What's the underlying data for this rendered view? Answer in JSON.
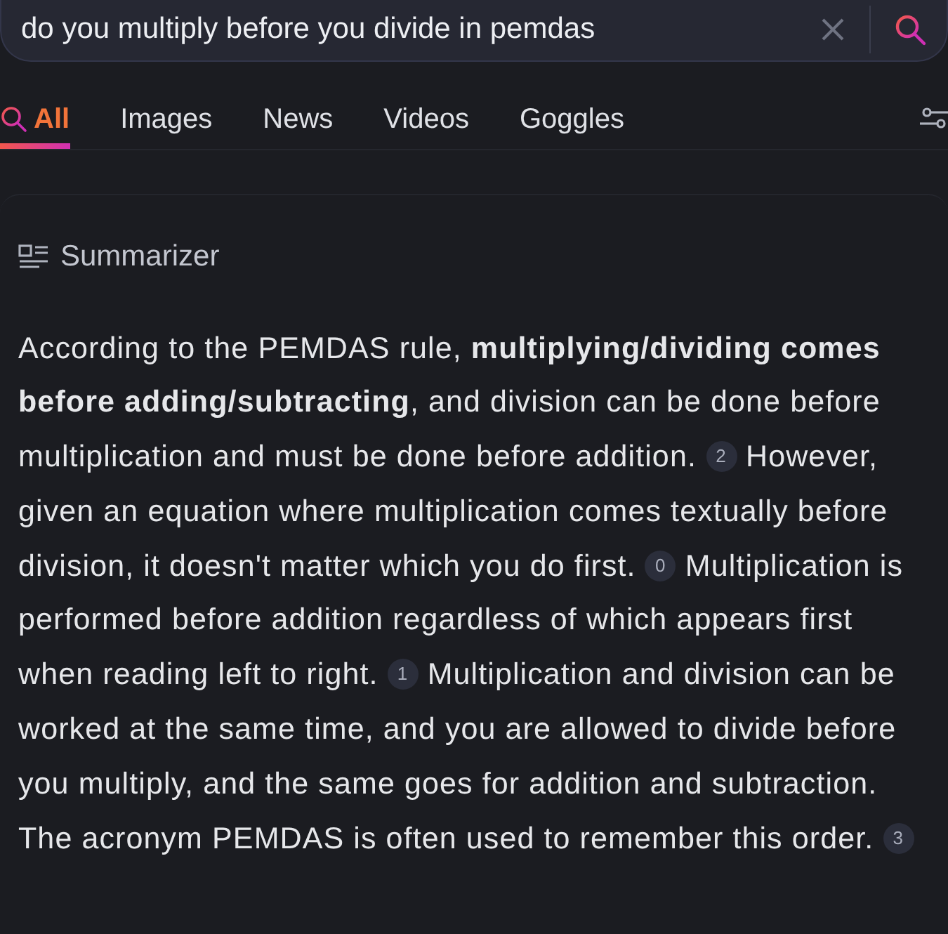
{
  "search": {
    "query": "do you multiply before you divide in pemdas"
  },
  "tabs": [
    {
      "label": "All",
      "selected": true
    },
    {
      "label": "Images",
      "selected": false
    },
    {
      "label": "News",
      "selected": false
    },
    {
      "label": "Videos",
      "selected": false
    },
    {
      "label": "Goggles",
      "selected": false
    }
  ],
  "summarizer": {
    "title": "Summarizer",
    "segments": [
      {
        "kind": "text",
        "text": "According to the PEMDAS rule, **multiplying/dividing comes before adding/subtracting**, and division can be done before multiplication and must be done before addition. "
      },
      {
        "kind": "citation",
        "text": "2"
      },
      {
        "kind": "text",
        "text": " However, given an equation where multiplication comes textually before division, it doesn't matter which you do first. "
      },
      {
        "kind": "citation",
        "text": "0"
      },
      {
        "kind": "text",
        "text": " Multiplication is performed before addition regardless of which appears first when reading left to right. "
      },
      {
        "kind": "citation",
        "text": "1"
      },
      {
        "kind": "text",
        "text": " Multiplication and division can be worked at the same time, and you are allowed to divide before you multiply, and the same goes for addition and subtraction. The acronym PEMDAS is often used to remember this order. "
      },
      {
        "kind": "citation",
        "text": "3"
      }
    ]
  }
}
